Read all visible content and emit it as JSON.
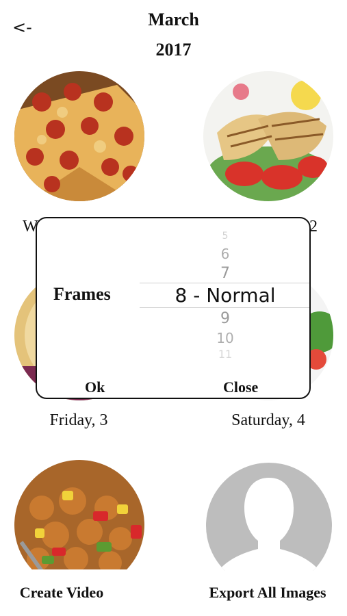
{
  "header": {
    "back_label": "<-",
    "month": "March",
    "year": "2017"
  },
  "row1": {
    "left_label_partial": "W",
    "right_label_partial": "2"
  },
  "row2": {
    "left_label": "Friday, 3",
    "right_label": "Saturday, 4"
  },
  "bottom": {
    "create_video_label": "Create Video",
    "export_label": "Export All Images"
  },
  "dialog": {
    "label": "Frames",
    "picker_items": [
      "5",
      "6",
      "7",
      "8 - Normal",
      "9",
      "10",
      "11"
    ],
    "selected": "8 - Normal",
    "ok_label": "Ok",
    "close_label": "Close"
  },
  "colors": {
    "accent": "#111111",
    "placeholder_bg": "#bdbdbd"
  }
}
